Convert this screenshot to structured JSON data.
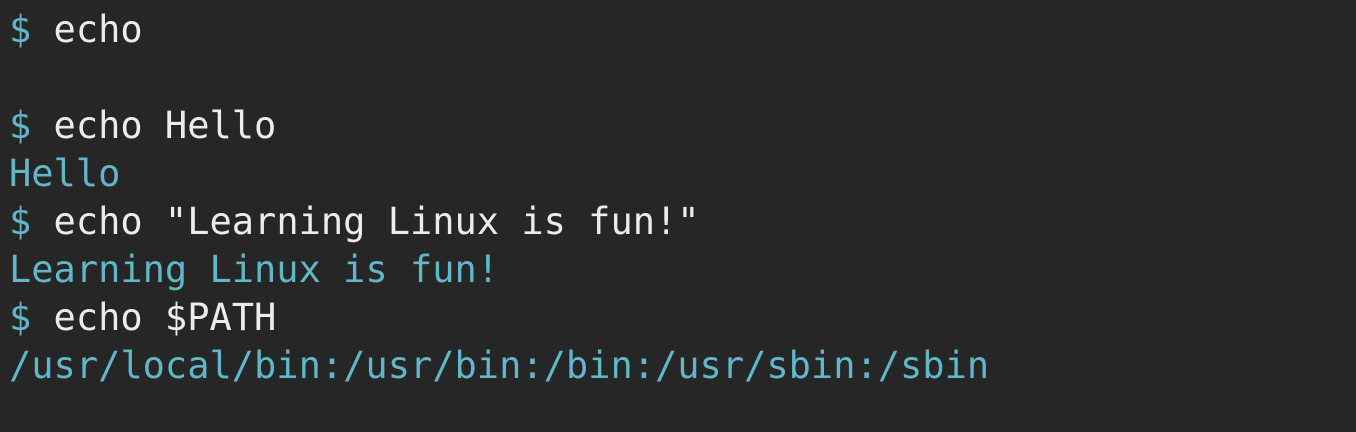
{
  "terminal": {
    "prompt_symbol": "$",
    "colors": {
      "background": "#262626",
      "command_text": "#ececec",
      "output_text": "#5fb7c7",
      "prompt": "#5fb7c7"
    },
    "lines": [
      {
        "type": "command",
        "prompt": "$",
        "text": " echo"
      },
      {
        "type": "blank",
        "text": ""
      },
      {
        "type": "command",
        "prompt": "$",
        "text": " echo Hello"
      },
      {
        "type": "output",
        "text": "Hello"
      },
      {
        "type": "command",
        "prompt": "$",
        "text": " echo \"Learning Linux is fun!\""
      },
      {
        "type": "output",
        "text": "Learning Linux is fun!"
      },
      {
        "type": "command",
        "prompt": "$",
        "text": " echo $PATH"
      },
      {
        "type": "output",
        "text": "/usr/local/bin:/usr/bin:/bin:/usr/sbin:/sbin"
      }
    ]
  }
}
